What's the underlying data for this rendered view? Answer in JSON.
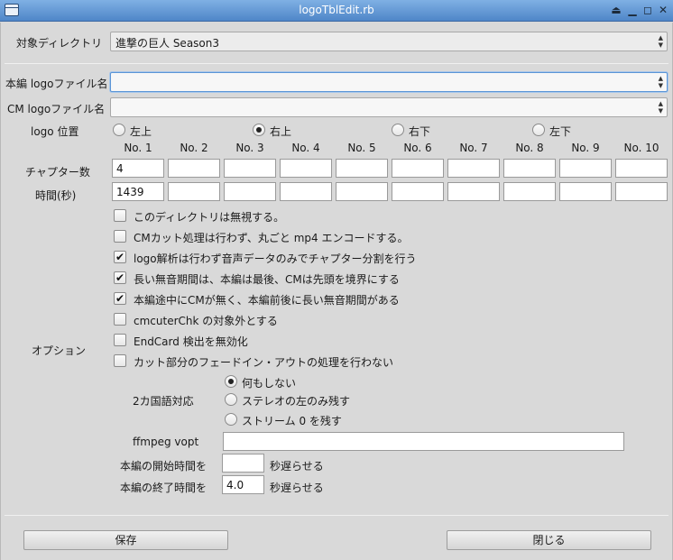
{
  "window": {
    "title": "logoTblEdit.rb"
  },
  "target_dir": {
    "label": "対象ディレクトリ",
    "value": "進撃の巨人 Season3"
  },
  "main_logo": {
    "label": "本編 logoファイル名",
    "value": ""
  },
  "cm_logo": {
    "label": "CM logoファイル名",
    "value": ""
  },
  "logo_position": {
    "label": "logo 位置",
    "options": [
      "左上",
      "右上",
      "右下",
      "左下"
    ],
    "selected": "右上"
  },
  "chapters": {
    "headers": [
      "No. 1",
      "No. 2",
      "No. 3",
      "No. 4",
      "No. 5",
      "No. 6",
      "No. 7",
      "No. 8",
      "No. 9",
      "No. 10"
    ],
    "count_label": "チャプター数",
    "time_label": "時間(秒)",
    "counts": [
      "4",
      "",
      "",
      "",
      "",
      "",
      "",
      "",
      "",
      ""
    ],
    "times": [
      "1439",
      "",
      "",
      "",
      "",
      "",
      "",
      "",
      "",
      ""
    ]
  },
  "options": {
    "label": "オプション",
    "checks": [
      {
        "label": "このディレクトリは無視する。",
        "checked": false
      },
      {
        "label": "CMカット処理は行わず、丸ごと mp4 エンコードする。",
        "checked": false
      },
      {
        "label": "logo解析は行わず音声データのみでチャプター分割を行う",
        "checked": true
      },
      {
        "label": "長い無音期間は、本編は最後、CMは先頭を境界にする",
        "checked": true
      },
      {
        "label": "本編途中にCMが無く、本編前後に長い無音期間がある",
        "checked": true
      },
      {
        "label": "cmcuterChk の対象外とする",
        "checked": false
      },
      {
        "label": "EndCard 検出を無効化",
        "checked": false
      },
      {
        "label": "カット部分のフェードイン・アウトの処理を行わない",
        "checked": false
      }
    ]
  },
  "bilingual": {
    "label": "2カ国語対応",
    "options": [
      "何もしない",
      "ステレオの左のみ残す",
      "ストリーム 0 を残す"
    ],
    "selected": "何もしない"
  },
  "ffmpeg": {
    "label": "ffmpeg vopt",
    "value": ""
  },
  "start_delay": {
    "label": "本編の開始時間を",
    "value": "",
    "suffix": "秒遅らせる"
  },
  "end_delay": {
    "label": "本編の終了時間を",
    "value": "4.0",
    "suffix": "秒遅らせる"
  },
  "buttons": {
    "save": "保存",
    "close": "閉じる"
  },
  "icons": {
    "eject": "eject-icon",
    "minimize": "minimize-icon",
    "maximize": "maximize-icon",
    "close": "close-icon",
    "menu": "window-menu-icon"
  }
}
